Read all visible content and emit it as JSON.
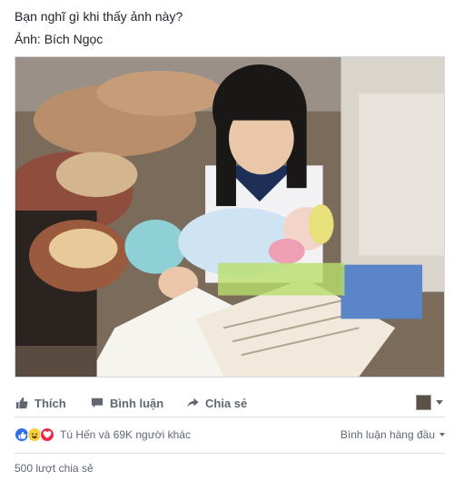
{
  "post": {
    "caption": "Bạn nghĩ gì khi thấy ảnh này?",
    "credit": "Ảnh: Bích Ngọc"
  },
  "photo": {
    "icon": "photo-of-girl-with-baby-studying"
  },
  "actions": {
    "like_label": "Thích",
    "comment_label": "Bình luận",
    "share_label": "Chia sẻ"
  },
  "reactions": {
    "icons": [
      "like-reaction-icon",
      "haha-reaction-icon",
      "love-reaction-icon"
    ],
    "summary": "Tú Hến và 69K người khác",
    "sort_label": "Bình luận hàng đầu"
  },
  "shares": {
    "count_label": "500 lượt chia sẻ"
  },
  "colors": {
    "text": "#1d2129",
    "muted": "#606770",
    "like": "#2f6fec",
    "haha": "#f7d13d",
    "love": "#f0284a"
  }
}
